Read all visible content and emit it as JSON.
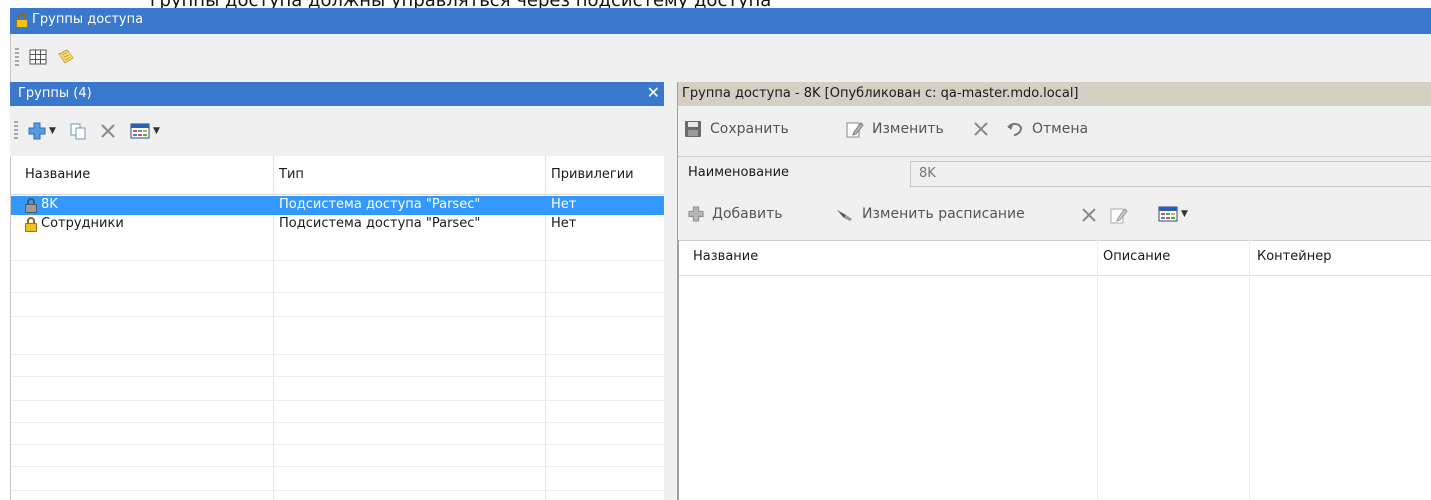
{
  "top_crop_text": "группы доступа должны управляться через подсистему доступа",
  "window": {
    "title": "Группы доступа"
  },
  "main_toolbar": {
    "icons": [
      "grid-icon",
      "notes-icon"
    ]
  },
  "groups_panel": {
    "header_title": "Группы (4)",
    "close_glyph": "✕",
    "toolbar_icons": [
      "add-icon",
      "copy-icon",
      "delete-icon",
      "columns-icon"
    ],
    "columns": [
      "Название",
      "Тип",
      "Привилегии"
    ],
    "rows": [
      {
        "name": "8K",
        "type": "Подсистема доступа \"Parsec\"",
        "privileges": "Нет",
        "selected": true,
        "icon": "lock-grey-icon"
      },
      {
        "name": "Сотрудники",
        "type": "Подсистема доступа \"Parsec\"",
        "privileges": "Нет",
        "selected": false,
        "icon": "lock-yellow-icon"
      }
    ]
  },
  "detail_panel": {
    "header_title": "Группа доступа - 8K [Опубликован с: qa-master.mdo.local]",
    "toolbar": {
      "save_label": "Сохранить",
      "edit_label": "Изменить",
      "cancel_label": "Отмена"
    },
    "name_field": {
      "label": "Наименование",
      "value": "8K"
    },
    "sub_toolbar": {
      "add_label": "Добавить",
      "schedule_label": "Изменить расписание"
    },
    "columns": [
      "Название",
      "Описание",
      "Контейнер"
    ]
  },
  "colors": {
    "titlebar": "#3a78cc",
    "selected_row": "#3399ff",
    "detail_header": "#d6d0c4",
    "toolbar_bg": "#f0f0f0"
  }
}
